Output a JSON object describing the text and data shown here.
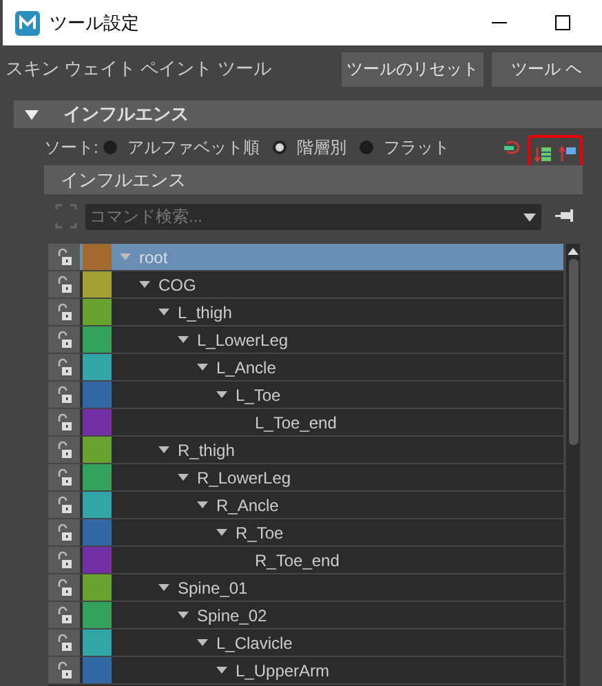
{
  "window": {
    "title": "ツール設定"
  },
  "tool": {
    "name": "スキン ウェイト ペイント ツール",
    "buttons": [
      "ツールのリセット",
      "ツール ヘ"
    ]
  },
  "section": {
    "title": "インフルエンス",
    "expanded": true
  },
  "sort": {
    "label": "ソート:",
    "options": [
      {
        "label": "アルファベット順",
        "selected": false
      },
      {
        "label": "階層別",
        "selected": true
      },
      {
        "label": "フラット",
        "selected": false
      }
    ]
  },
  "influences": {
    "title": "インフルエンス",
    "search": {
      "placeholder": "コマンド検索..."
    },
    "tree": [
      {
        "name": "root",
        "color": "#a36a30",
        "selected": true,
        "expanded": true,
        "children": [
          {
            "name": "COG",
            "color": "#a2a232",
            "selected": false,
            "expanded": true,
            "children": [
              {
                "name": "L_thigh",
                "color": "#6aa232",
                "selected": false,
                "expanded": true,
                "children": [
                  {
                    "name": "L_LowerLeg",
                    "color": "#32a25e",
                    "selected": false,
                    "expanded": true,
                    "children": [
                      {
                        "name": "L_Ancle",
                        "color": "#32a6a6",
                        "selected": false,
                        "expanded": true,
                        "children": [
                          {
                            "name": "L_Toe",
                            "color": "#3268a6",
                            "selected": false,
                            "expanded": true,
                            "children": [
                              {
                                "name": "L_Toe_end",
                                "color": "#7232a6",
                                "selected": false
                              }
                            ]
                          }
                        ]
                      }
                    ]
                  }
                ]
              },
              {
                "name": "R_thigh",
                "color": "#6aa232",
                "selected": false,
                "expanded": true,
                "children": [
                  {
                    "name": "R_LowerLeg",
                    "color": "#32a25e",
                    "selected": false,
                    "expanded": true,
                    "children": [
                      {
                        "name": "R_Ancle",
                        "color": "#32a6a6",
                        "selected": false,
                        "expanded": true,
                        "children": [
                          {
                            "name": "R_Toe",
                            "color": "#3268a6",
                            "selected": false,
                            "expanded": true,
                            "children": [
                              {
                                "name": "R_Toe_end",
                                "color": "#7232a6",
                                "selected": false
                              }
                            ]
                          }
                        ]
                      }
                    ]
                  }
                ]
              },
              {
                "name": "Spine_01",
                "color": "#6aa232",
                "selected": false,
                "expanded": true,
                "children": [
                  {
                    "name": "Spine_02",
                    "color": "#32a25e",
                    "selected": false,
                    "expanded": true,
                    "children": [
                      {
                        "name": "L_Clavicle",
                        "color": "#32a6a6",
                        "selected": false,
                        "expanded": true,
                        "children": [
                          {
                            "name": "L_UpperArm",
                            "color": "#3268a6",
                            "selected": false,
                            "expanded": true
                          }
                        ]
                      }
                    ]
                  }
                ]
              }
            ]
          }
        ]
      }
    ]
  }
}
